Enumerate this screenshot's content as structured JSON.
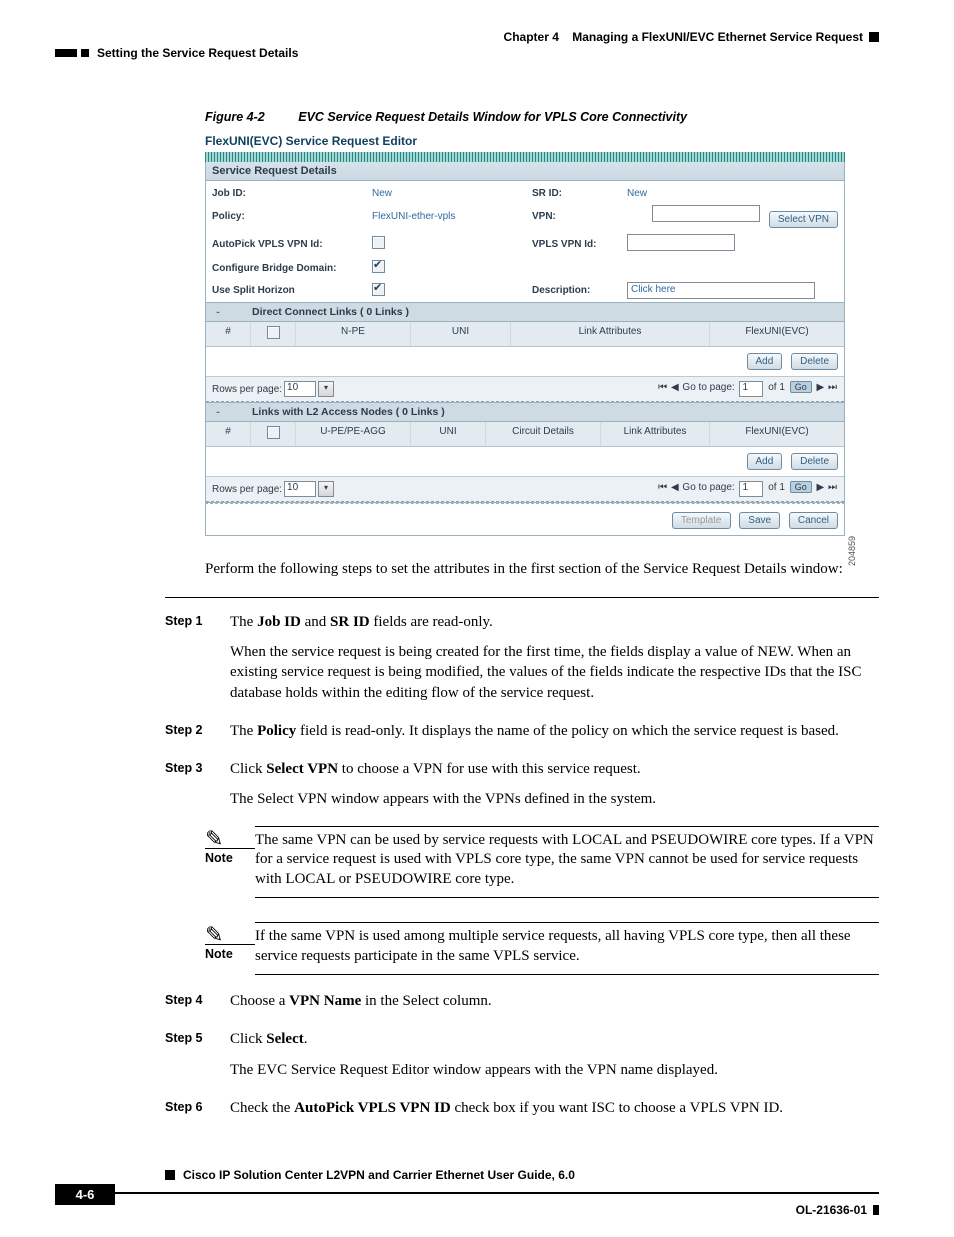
{
  "header": {
    "chapter_label": "Chapter 4",
    "chapter_title": "Managing a FlexUNI/EVC Ethernet Service Request",
    "section": "Setting the Service Request Details"
  },
  "figure": {
    "number": "Figure 4-2",
    "title": "EVC Service Request Details Window for VPLS Core Connectivity",
    "side_id": "204859"
  },
  "shot": {
    "window_title": "FlexUNI(EVC) Service Request Editor",
    "section_title": "Service Request Details",
    "fields": {
      "job_id_label": "Job ID:",
      "job_id_value": "New",
      "sr_id_label": "SR ID:",
      "sr_id_value": "New",
      "policy_label": "Policy:",
      "policy_value": "FlexUNI-ether-vpls",
      "vpn_label": "VPN:",
      "select_vpn_btn": "Select VPN",
      "autopick_label": "AutoPick VPLS VPN Id:",
      "vpls_vpn_id_label": "VPLS VPN Id:",
      "cfg_bridge_label": "Configure Bridge Domain:",
      "split_horizon_label": "Use Split Horizon",
      "description_label": "Description:",
      "description_placeholder": "Click here"
    },
    "direct_links": {
      "title": "Direct Connect Links  ( 0 Links )",
      "cols": {
        "c1": "#",
        "c2": "",
        "c3": "N-PE",
        "c4": "UNI",
        "c5": "Link Attributes",
        "c6": "FlexUNI(EVC)"
      },
      "add": "Add",
      "del": "Delete"
    },
    "l2_links": {
      "title": "Links with L2 Access Nodes  ( 0 Links )",
      "cols": {
        "c1": "#",
        "c2": "",
        "c3": "U-PE/PE-AGG",
        "c4": "UNI",
        "c5": "Circuit Details",
        "c6": "Link Attributes",
        "c7": "FlexUNI(EVC)"
      },
      "add": "Add",
      "del": "Delete"
    },
    "pager": {
      "rows_label": "Rows per page:",
      "rows_value": "10",
      "goto_label": "Go to page:",
      "goto_value": "1",
      "of_label": "of 1",
      "go": "Go"
    },
    "footer_buttons": {
      "template": "Template",
      "save": "Save",
      "cancel": "Cancel"
    }
  },
  "intro_text": "Perform the following steps to set the attributes in the first section of the Service Request Details window:",
  "steps": {
    "s1_label": "Step 1",
    "s1_a": "The ",
    "s1_b": "Job ID",
    "s1_c": " and ",
    "s1_d": "SR ID",
    "s1_e": " fields are read-only.",
    "s1_p2": "When the service request is being created for the first time, the fields display a value of NEW. When an existing service request is being modified, the values of the fields indicate the respective IDs that the ISC database holds within the editing flow of the service request.",
    "s2_label": "Step 2",
    "s2_a": "The ",
    "s2_b": "Policy",
    "s2_c": " field is read-only. It displays the name of the policy on which the service request is based.",
    "s3_label": "Step 3",
    "s3_a": "Click ",
    "s3_b": "Select VPN",
    "s3_c": " to choose a VPN for use with this service request.",
    "s3_p2": "The Select VPN window appears with the VPNs defined in the system.",
    "s4_label": "Step 4",
    "s4_a": "Choose a ",
    "s4_b": "VPN Name",
    "s4_c": " in the Select column.",
    "s5_label": "Step 5",
    "s5_a": "Click ",
    "s5_b": "Select",
    "s5_c": ".",
    "s5_p2": "The EVC Service Request Editor window appears with the VPN name displayed.",
    "s6_label": "Step 6",
    "s6_a": "Check the ",
    "s6_b": "AutoPick VPLS VPN ID",
    "s6_c": " check box if you want ISC to choose a VPLS VPN ID."
  },
  "notes": {
    "label": "Note",
    "n1": "The same VPN can be used by service requests with LOCAL and PSEUDOWIRE core types. If a VPN for a service request is used with VPLS core type, the same VPN cannot be used for service requests with LOCAL or PSEUDOWIRE core type.",
    "n2": "If the same VPN is used among multiple service requests, all having VPLS core type, then all these service requests participate in the same VPLS service."
  },
  "footer": {
    "doc_title": "Cisco IP Solution Center L2VPN and Carrier Ethernet User Guide, 6.0",
    "page": "4-6",
    "ol": "OL-21636-01"
  }
}
